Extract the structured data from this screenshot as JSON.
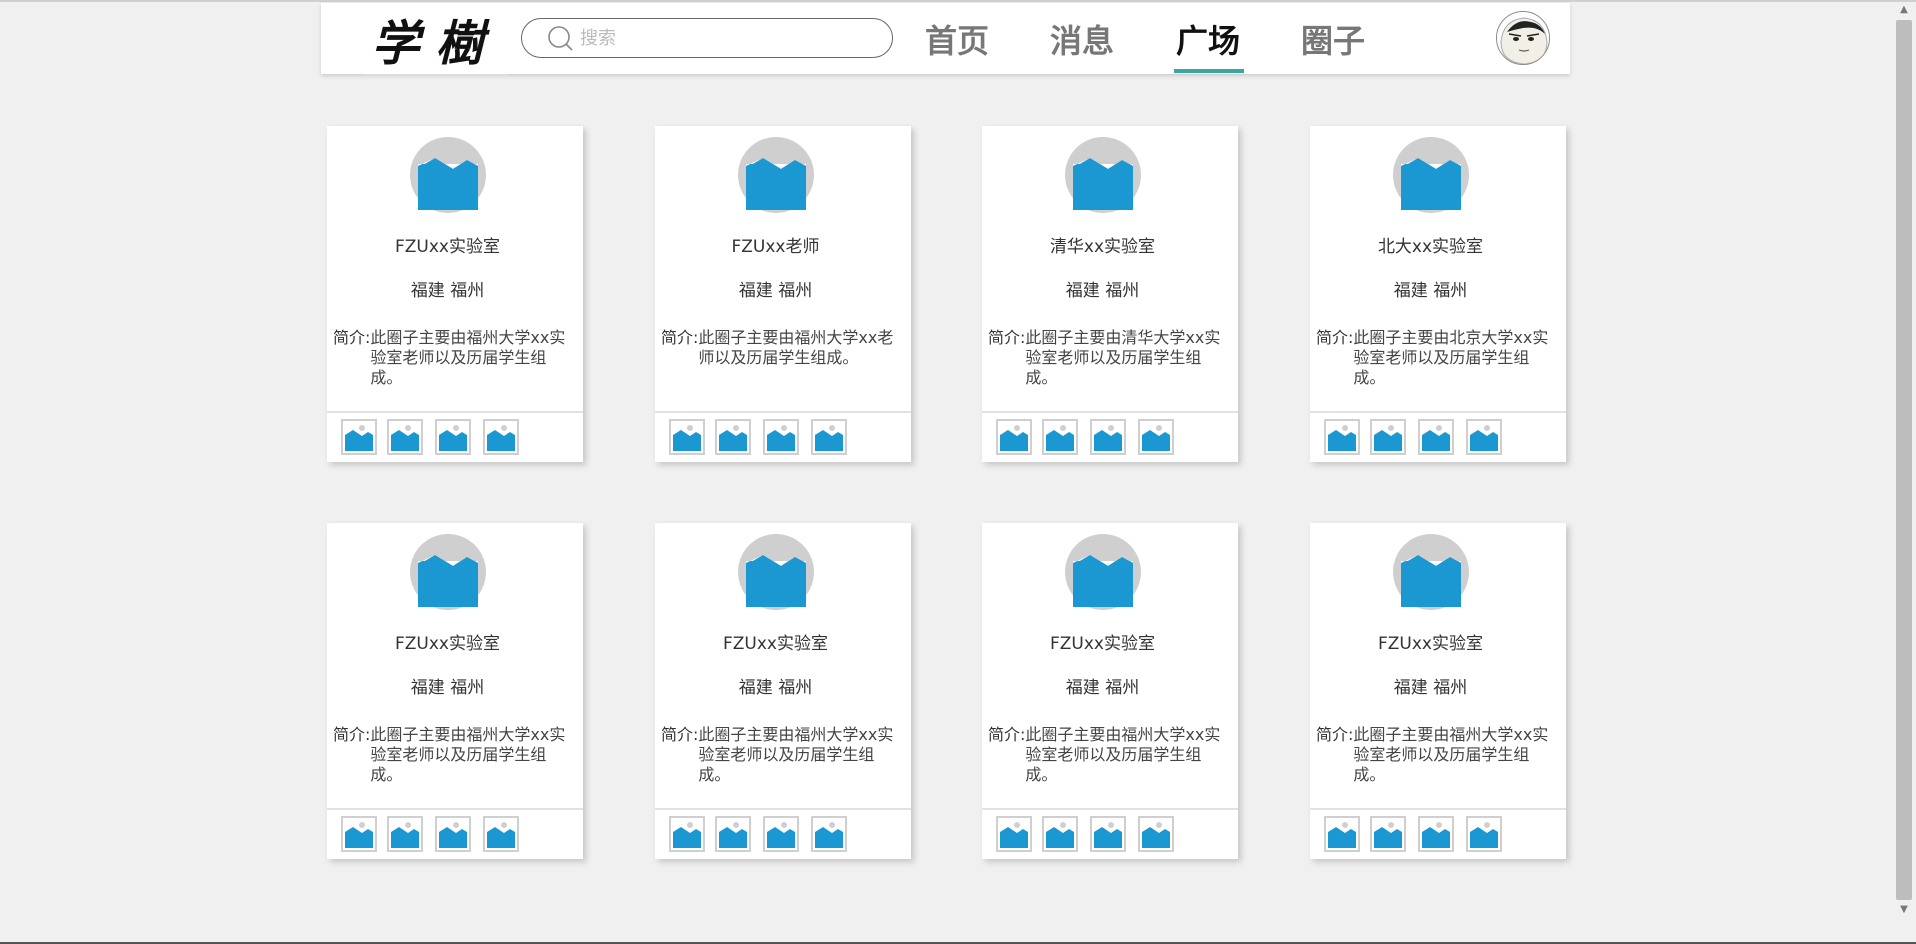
{
  "header": {
    "logo_text": "学樹",
    "search_placeholder": "搜索",
    "nav": [
      "首页",
      "消息",
      "广场",
      "圈子"
    ],
    "active_nav": "广场",
    "accent_color": "#3aa79f"
  },
  "colors": {
    "image_blue": "#1b98d2",
    "image_gray": "#cfcfcf"
  },
  "intro_label": "简介:",
  "cards": [
    {
      "name": "FZUxx实验室",
      "location": "福建 福州",
      "intro": "此圈子主要由福州大学xx实验室老师以及历届学生组成。"
    },
    {
      "name": "FZUxx老师",
      "location": "福建 福州",
      "intro": "此圈子主要由福州大学xx老师以及历届学生组成。"
    },
    {
      "name": "清华xx实验室",
      "location": "福建 福州",
      "intro": "此圈子主要由清华大学xx实验室老师以及历届学生组成。"
    },
    {
      "name": "北大xx实验室",
      "location": "福建 福州",
      "intro": "此圈子主要由北京大学xx实验室老师以及历届学生组成。"
    },
    {
      "name": "FZUxx实验室",
      "location": "福建 福州",
      "intro": "此圈子主要由福州大学xx实验室老师以及历届学生组成。"
    },
    {
      "name": "FZUxx实验室",
      "location": "福建 福州",
      "intro": "此圈子主要由福州大学xx实验室老师以及历届学生组成。"
    },
    {
      "name": "FZUxx实验室",
      "location": "福建 福州",
      "intro": "此圈子主要由福州大学xx实验室老师以及历届学生组成。"
    },
    {
      "name": "FZUxx实验室",
      "location": "福建 福州",
      "intro": "此圈子主要由福州大学xx实验室老师以及历届学生组成。"
    }
  ]
}
